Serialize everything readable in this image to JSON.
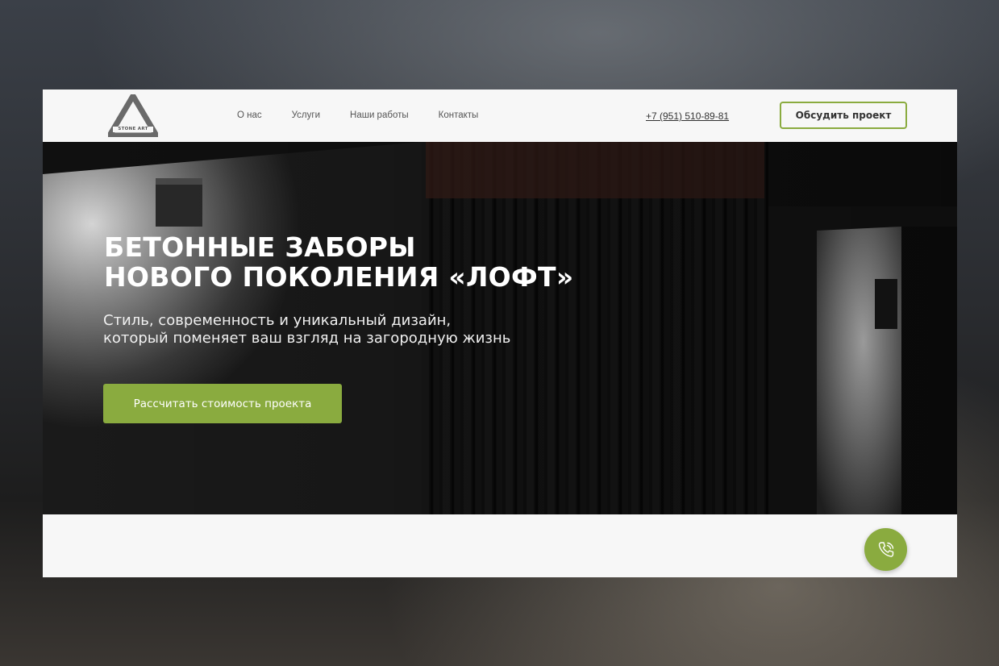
{
  "header": {
    "logo_text": "STONE ART",
    "nav": [
      "О нас",
      "Услуги",
      "Наши работы",
      "Контакты"
    ],
    "phone": "+7 (951) 510-89-81",
    "cta_label": "Обсудить проект"
  },
  "hero": {
    "title_lines": [
      "БЕТОННЫЕ ЗАБОРЫ",
      "НОВОГО ПОКОЛЕНИЯ «ЛОФТ»"
    ],
    "subtitle_lines": [
      "Стиль, современность и уникальный дизайн,",
      "который поменяет ваш взгляд на загородную жизнь"
    ],
    "button_label": "Рассчитать стоимость проекта"
  },
  "colors": {
    "accent": "#8aab3f",
    "page_bg": "#f7f7f7",
    "hero_bg": "#0c0c0c"
  },
  "icons": {
    "logo": "triangle-logo-icon",
    "call": "phone-call-icon"
  }
}
